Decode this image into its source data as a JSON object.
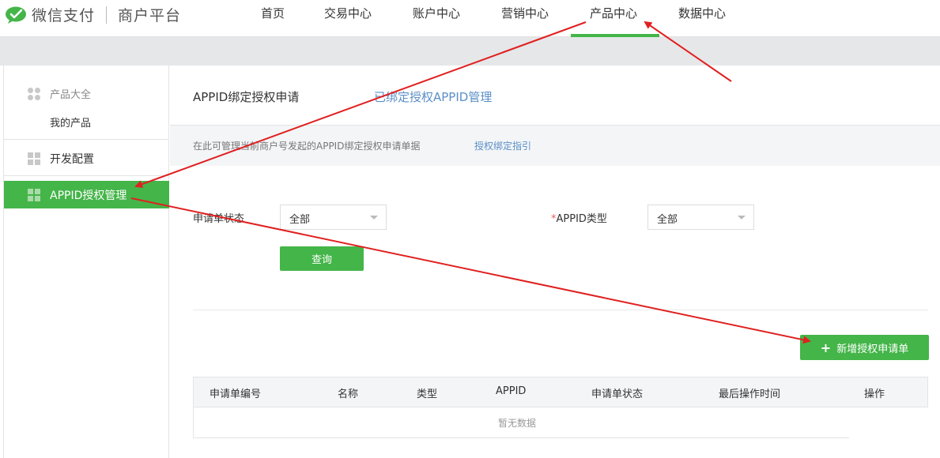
{
  "header": {
    "brand": "微信支付",
    "brand_sub": "商户平台",
    "nav": [
      {
        "label": "首页"
      },
      {
        "label": "交易中心"
      },
      {
        "label": "账户中心"
      },
      {
        "label": "营销中心"
      },
      {
        "label": "产品中心",
        "active": true
      },
      {
        "label": "数据中心"
      }
    ]
  },
  "sidebar": {
    "group_title": "产品大全",
    "group_sub": "我的产品",
    "items": [
      {
        "label": "开发配置"
      },
      {
        "label": "APPID授权管理",
        "active": true
      }
    ]
  },
  "main": {
    "title": "APPID绑定授权申请",
    "tab_link": "已绑定授权APPID管理",
    "info_text": "在此可管理当前商户号发起的APPID绑定授权申请单据",
    "info_link": "授权绑定指引",
    "filters": {
      "status_label": "申请单状态",
      "status_value": "全部",
      "type_required": "*",
      "type_label": "APPID类型",
      "type_value": "全部"
    },
    "query_button": "查询",
    "add_button": "新增授权申请单",
    "table": {
      "columns": [
        "申请单编号",
        "名称",
        "类型",
        "APPID",
        "申请单状态",
        "最后操作时间",
        "操作"
      ],
      "empty_text": "暂无数据"
    }
  },
  "colors": {
    "accent_green": "#44b549",
    "link_blue": "#5b8fc7",
    "annotation_red": "#e02020"
  }
}
